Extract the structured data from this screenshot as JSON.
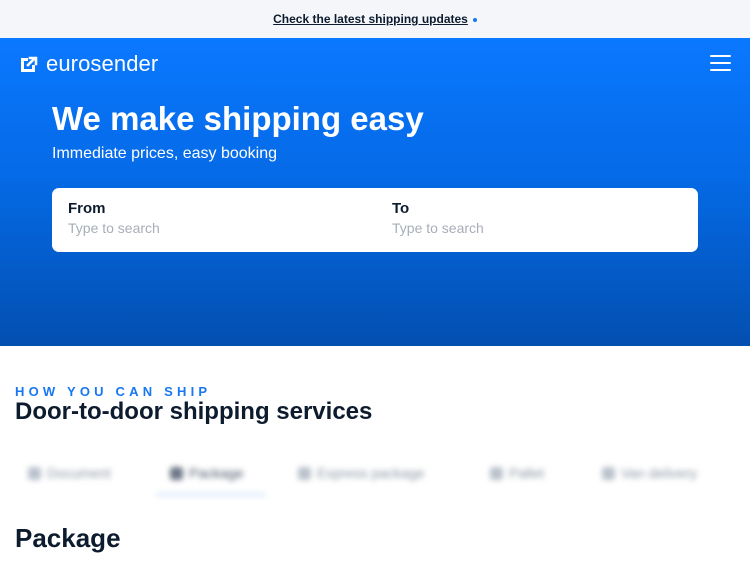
{
  "announcement": {
    "link_text": "Check the latest shipping updates"
  },
  "header": {
    "brand": "eurosender",
    "menu_icon": "hamburger-menu-icon",
    "logo_icon": "eurosender-logo-icon"
  },
  "hero": {
    "title": "We make shipping easy",
    "subtitle": "Immediate prices, easy booking",
    "search": {
      "from_label": "From",
      "from_placeholder": "Type to search",
      "from_value": "",
      "to_label": "To",
      "to_placeholder": "Type to search",
      "to_value": ""
    }
  },
  "services": {
    "eyebrow": "HOW YOU CAN SHIP",
    "title": "Door-to-door shipping services",
    "tabs": [
      {
        "label": "Document",
        "icon": "document-icon",
        "active": false
      },
      {
        "label": "Package",
        "icon": "package-icon",
        "active": true
      },
      {
        "label": "Express package",
        "icon": "express-package-icon",
        "active": false
      },
      {
        "label": "Pallet",
        "icon": "pallet-icon",
        "active": false
      },
      {
        "label": "Van delivery",
        "icon": "van-icon",
        "active": false
      }
    ]
  },
  "package_section": {
    "title": "Package"
  },
  "colors": {
    "brand_blue": "#1877f2",
    "hero_top": "#0a78ff",
    "hero_bottom": "#034fb0",
    "text_dark": "#0d1b2e"
  }
}
